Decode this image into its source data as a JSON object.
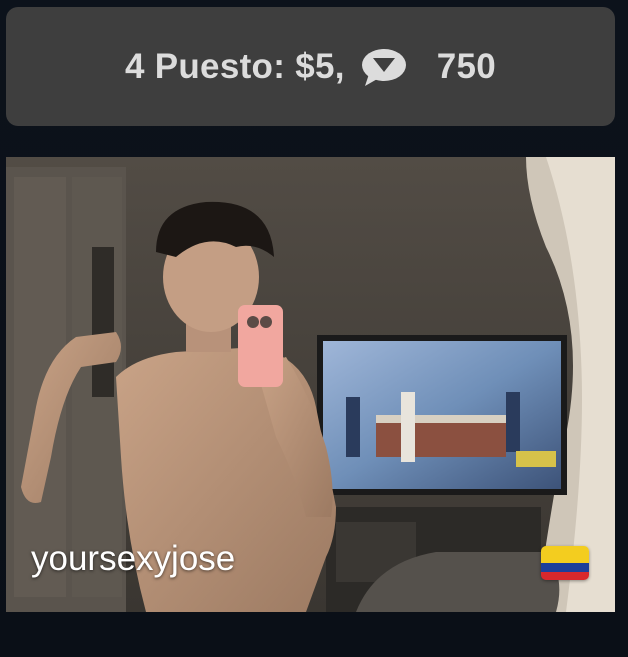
{
  "banner": {
    "rank_text": "4 Puesto: $5,",
    "comment_count": "750",
    "icon": "speech-bubble-icon"
  },
  "profile": {
    "username": "yoursexyjose",
    "flag_icon": "colombia-flag-icon",
    "flag_colors": [
      "#f3cd1f",
      "#1d3f9a",
      "#d8282c"
    ]
  }
}
